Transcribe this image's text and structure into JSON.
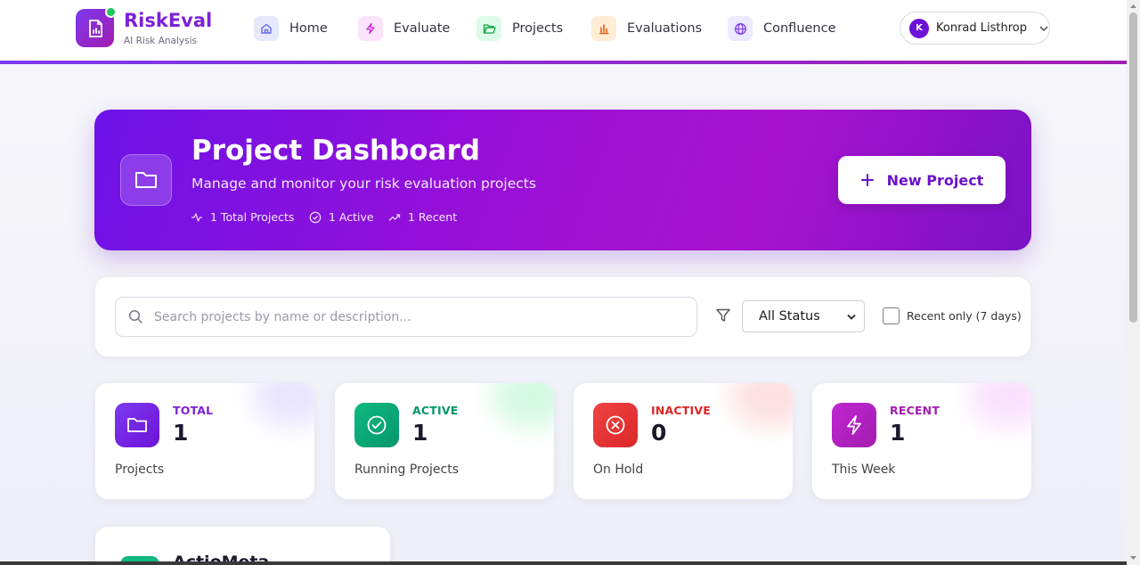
{
  "brand": {
    "name": "RiskEval",
    "subtitle": "AI Risk Analysis"
  },
  "nav": [
    {
      "label": "Home",
      "icon": "home-icon",
      "color": "#6366f1",
      "bg": "#e7e8fb"
    },
    {
      "label": "Evaluate",
      "icon": "bolt-icon",
      "color": "#c026d3",
      "bg": "#fbe4fb"
    },
    {
      "label": "Projects",
      "icon": "folder-open-icon",
      "color": "#16a34a",
      "bg": "#dcfce7"
    },
    {
      "label": "Evaluations",
      "icon": "bar-chart-icon",
      "color": "#ea580c",
      "bg": "#ffedd5"
    },
    {
      "label": "Confluence",
      "icon": "globe-icon",
      "color": "#7c3aed",
      "bg": "#ede9fe"
    }
  ],
  "user": {
    "initial": "K",
    "name": "Konrad Listhrop"
  },
  "hero": {
    "title": "Project Dashboard",
    "subtitle": "Manage and monitor your risk evaluation projects",
    "stats": [
      {
        "label": "1 Total Projects",
        "icon": "activity-icon"
      },
      {
        "label": "1 Active",
        "icon": "check-circle-icon"
      },
      {
        "label": "1 Recent",
        "icon": "trending-up-icon"
      }
    ],
    "new_button": "New Project"
  },
  "filters": {
    "search_placeholder": "Search projects by name or description...",
    "status_selected": "All Status",
    "recent_label": "Recent only (7 days)",
    "recent_checked": false
  },
  "stats": [
    {
      "label": "TOTAL",
      "value": "1",
      "caption": "Projects",
      "color": "#7c22d9",
      "icon": "folder-icon"
    },
    {
      "label": "ACTIVE",
      "value": "1",
      "caption": "Running Projects",
      "color": "#059669",
      "icon": "check-circle-icon"
    },
    {
      "label": "INACTIVE",
      "value": "0",
      "caption": "On Hold",
      "color": "#dc2626",
      "icon": "x-circle-icon"
    },
    {
      "label": "RECENT",
      "value": "1",
      "caption": "This Week",
      "color": "#a21caf",
      "icon": "bolt-icon"
    }
  ],
  "projects": [
    {
      "name": "ActioMeta"
    }
  ]
}
